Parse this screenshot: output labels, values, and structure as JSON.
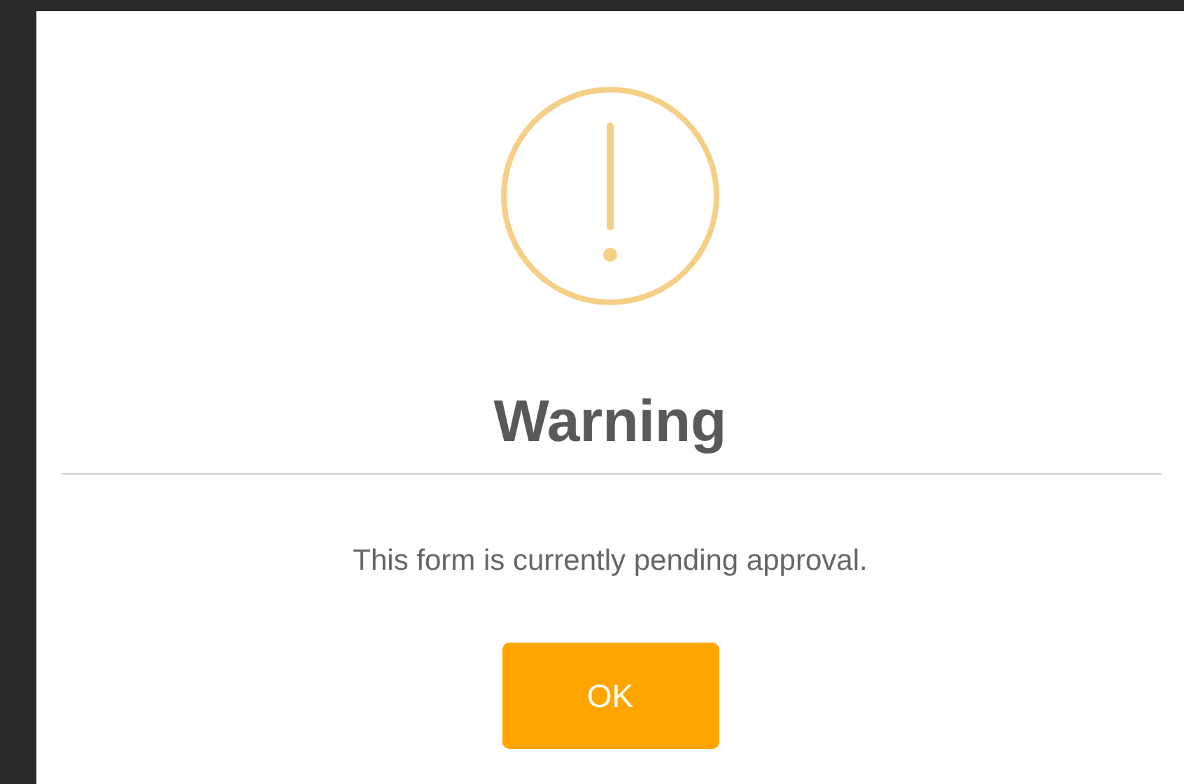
{
  "dialog": {
    "title": "Warning",
    "message": "This form is currently pending approval.",
    "buttons": [
      "OK"
    ]
  }
}
